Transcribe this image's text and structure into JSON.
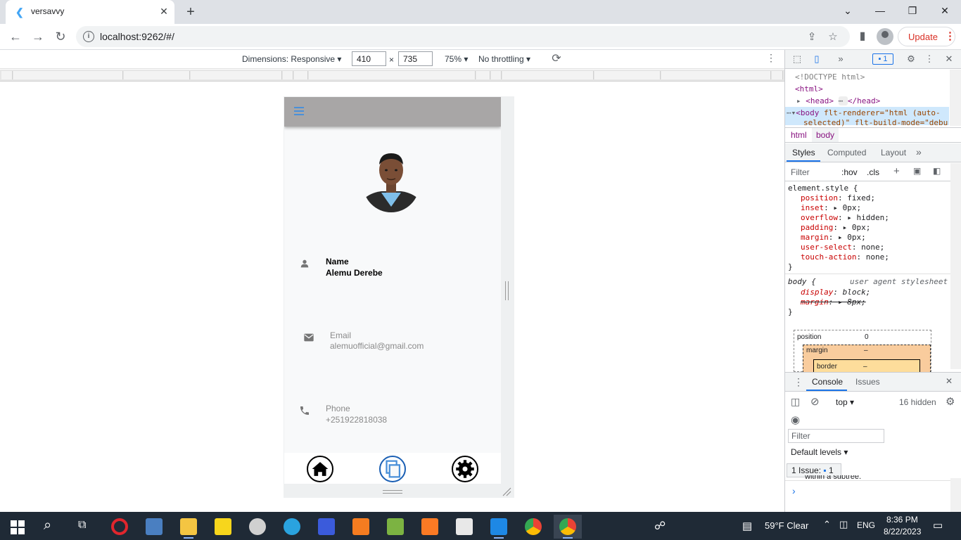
{
  "browser": {
    "tab_title": "versavvy",
    "tab_close": "✕",
    "new_tab": "+",
    "url": "localhost:9262/#/",
    "update_label": "Update"
  },
  "device_toolbar": {
    "dimensions_label": "Dimensions: Responsive ▾",
    "width": "410",
    "times": "×",
    "height": "735",
    "zoom": "75% ▾",
    "throttling": "No throttling ▾"
  },
  "app": {
    "profile": {
      "name_label": "Name",
      "name_value": "Alemu Derebe",
      "email_label": "Email",
      "email_value": "alemuofficial@gmail.com",
      "phone_label": "Phone",
      "phone_value": "+251922818038"
    }
  },
  "devtools": {
    "issues_badge": "1",
    "dom": {
      "doctype": "<!DOCTYPE html>",
      "html_open": "<html>",
      "head": "<head>",
      "head_close": "</head>",
      "body_line1": "flt-renderer=\"html (auto-",
      "body_line2": "selected)\" flt-build-mode=\"debu"
    },
    "crumbs": [
      "html",
      "body"
    ],
    "styles_tabs": [
      "Styles",
      "Computed",
      "Layout"
    ],
    "filter_placeholder": "Filter",
    "hov": ":hov",
    "cls": ".cls",
    "styles": {
      "element_style": "element.style {",
      "props": [
        {
          "name": "position",
          "value": "fixed;"
        },
        {
          "name": "inset",
          "value": "▸ 0px;"
        },
        {
          "name": "overflow",
          "value": "▸ hidden;"
        },
        {
          "name": "padding",
          "value": "▸ 0px;"
        },
        {
          "name": "margin",
          "value": "▸ 0px;"
        },
        {
          "name": "user-select",
          "value": "none;"
        },
        {
          "name": "touch-action",
          "value": "none;"
        }
      ],
      "close_brace": "}",
      "body_rule": "body {",
      "ua_label": "user agent stylesheet",
      "display_prop": "display",
      "display_val": "block;",
      "margin_prop": "margin",
      "margin_val": "▸ 8px;"
    },
    "boxmodel": {
      "position_label": "position",
      "position_value": "0",
      "margin_label": "margin",
      "margin_value": "–",
      "border_label": "border",
      "border_value": "–"
    },
    "console": {
      "tabs": [
        "Console",
        "Issues"
      ],
      "context": "top ▾",
      "hidden": "16 hidden",
      "filter_placeholder": "Filter",
      "levels": "Default levels ▾",
      "issue_chip": "1 Issue:",
      "issue_chip_count": "1",
      "truncated_line": "within a subtree.",
      "prompt": "›"
    }
  },
  "taskbar": {
    "weather": "59°F  Clear",
    "lang": "ENG",
    "time": "8:36 PM",
    "date": "8/22/2023"
  },
  "colors": {
    "app_bar": "#a8a6a6",
    "accent_blue": "#1a73e8",
    "update_red": "#d93025",
    "taskbar": "#1f2a36"
  }
}
